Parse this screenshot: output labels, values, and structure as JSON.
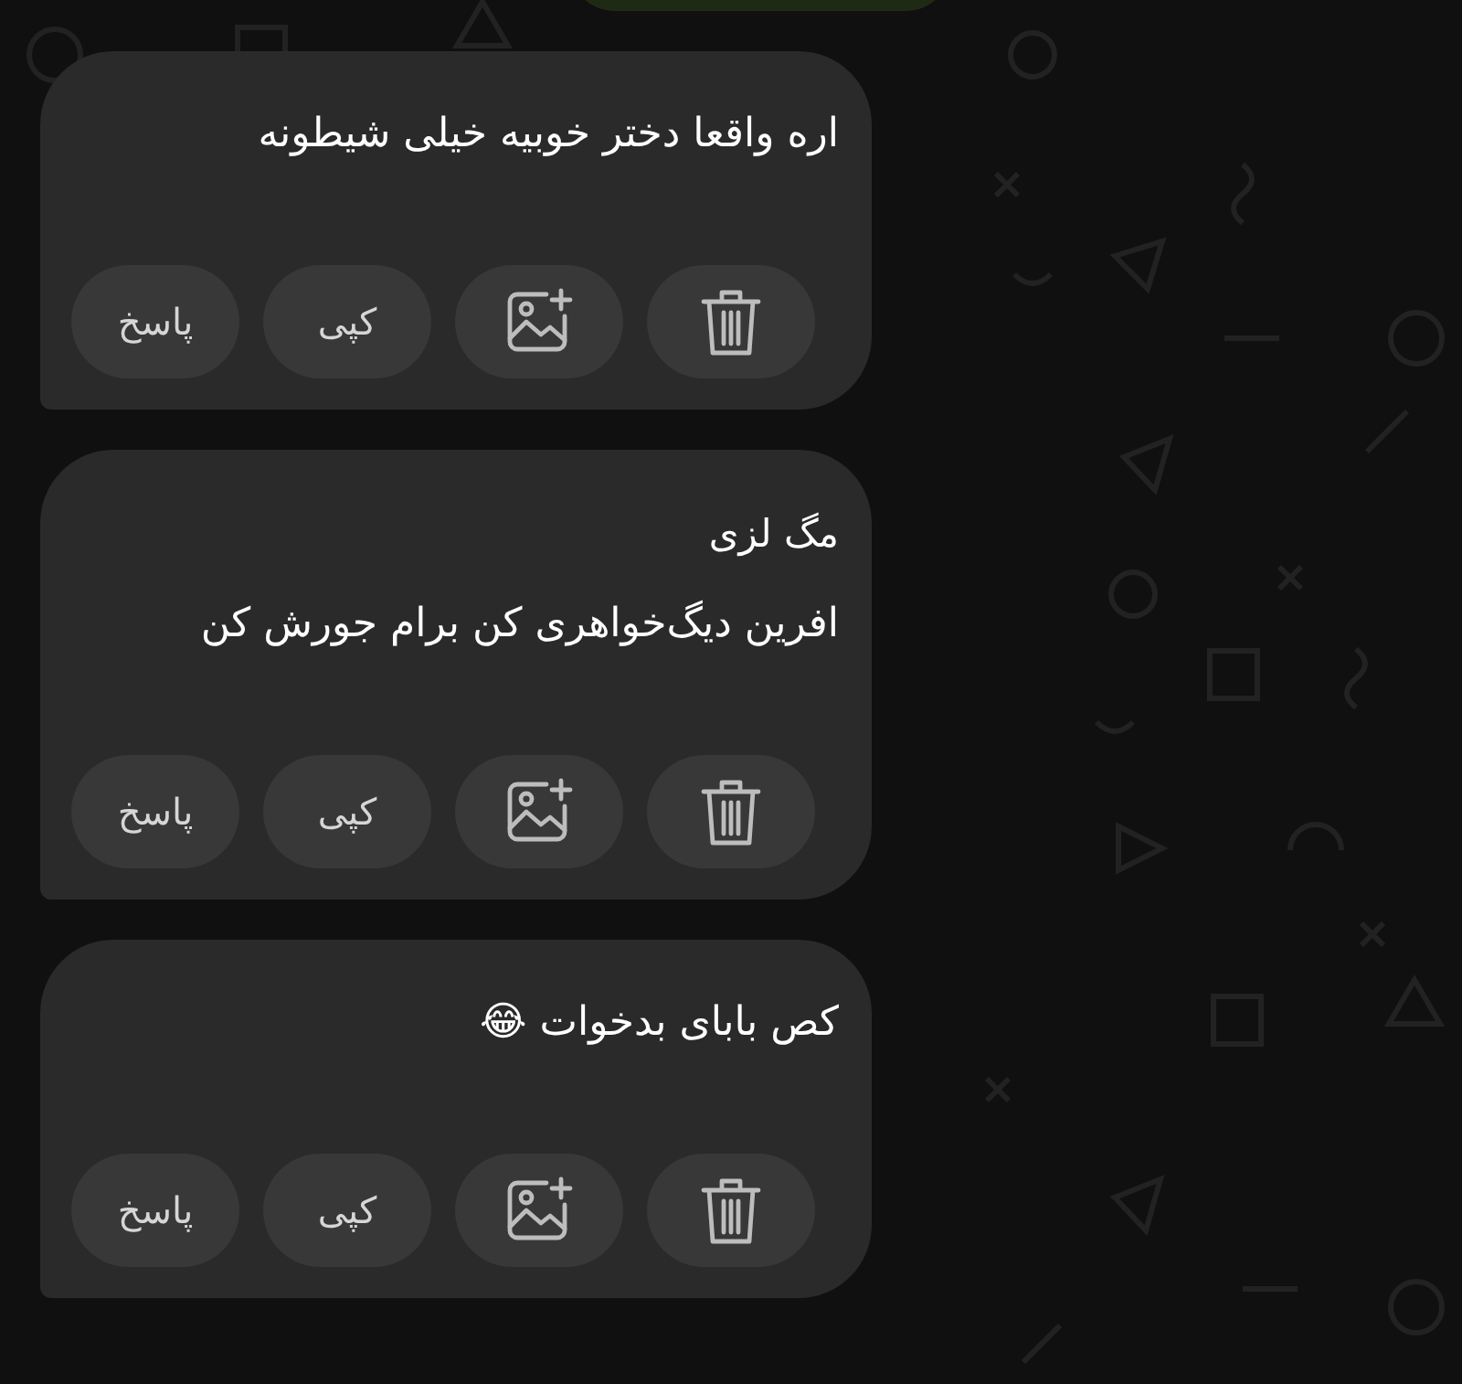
{
  "messages": [
    {
      "text": "اره واقعا دختر خوبیه خیلی شیطونه",
      "actions": [
        "کپی",
        "پاسخ"
      ]
    },
    {
      "sender": "مگ لزی",
      "text": "افرین دیگ‌خواهری کن برام جورش کن",
      "actions": [
        "کپی",
        "پاسخ"
      ]
    },
    {
      "text": "کص بابای بدخوات 😂",
      "actions": [
        "کپی",
        "پاسخ"
      ]
    }
  ]
}
